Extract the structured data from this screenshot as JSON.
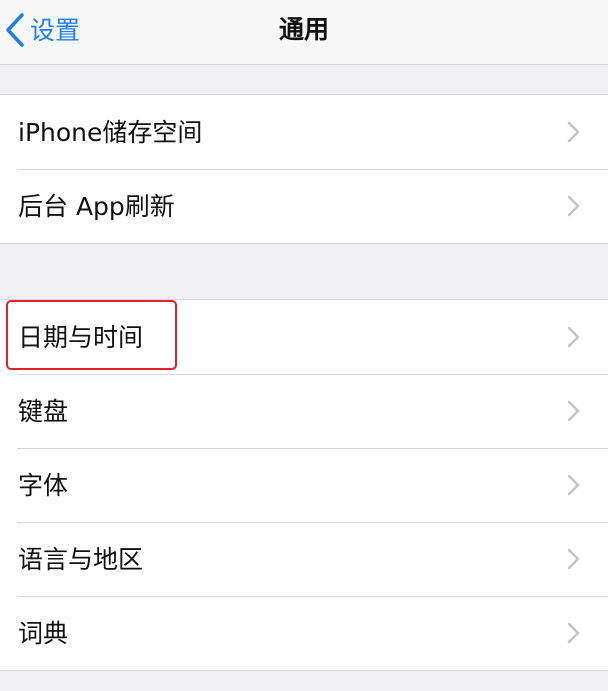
{
  "navbar": {
    "back_label": "设置",
    "title": "通用"
  },
  "groups": [
    {
      "items": [
        {
          "label": "iPhone储存空间"
        },
        {
          "label": "后台 App刷新"
        }
      ]
    },
    {
      "items": [
        {
          "label": "日期与时间",
          "highlighted": true
        },
        {
          "label": "键盘"
        },
        {
          "label": "字体"
        },
        {
          "label": "语言与地区"
        },
        {
          "label": "词典"
        }
      ]
    }
  ],
  "icons": {
    "back": "chevron-left-icon",
    "row_disclosure": "chevron-right-icon"
  },
  "colors": {
    "accent": "#1f7ef6",
    "highlight": "#e0222b",
    "background": "#efeff4"
  }
}
